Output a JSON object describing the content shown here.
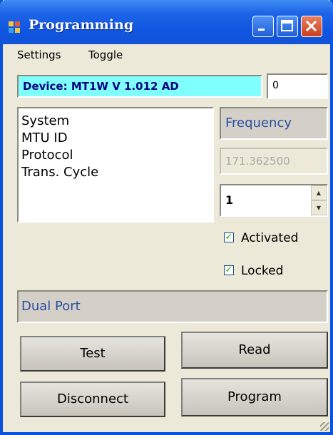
{
  "window": {
    "title": "Programming",
    "accent": "#0a53dc",
    "icon": "app-window-icon",
    "controls": [
      "minimize-icon",
      "maximize-icon",
      "close-icon"
    ]
  },
  "menu": {
    "items": [
      {
        "label": "Settings"
      },
      {
        "label": "Toggle"
      }
    ]
  },
  "device": {
    "label": "Device: MT1W V 1.012 AD",
    "highlight": "#80ffff",
    "count_value": "0"
  },
  "parameters": {
    "items": [
      {
        "label": "System"
      },
      {
        "label": "MTU ID"
      },
      {
        "label": "Protocol"
      },
      {
        "label": "Trans. Cycle"
      }
    ]
  },
  "frequency": {
    "label": "Frequency",
    "value": "171.362500"
  },
  "stepper": {
    "value": "1",
    "up_icon": "spin-up-arrow-icon",
    "down_icon": "spin-down-arrow-icon"
  },
  "options": {
    "activated": {
      "label": "Activated",
      "checked": true
    },
    "locked": {
      "label": "Locked",
      "checked": true
    }
  },
  "port": {
    "label": "Dual Port"
  },
  "buttons": {
    "test": "Test",
    "read": "Read",
    "disconnect": "Disconnect",
    "program": "Program"
  }
}
